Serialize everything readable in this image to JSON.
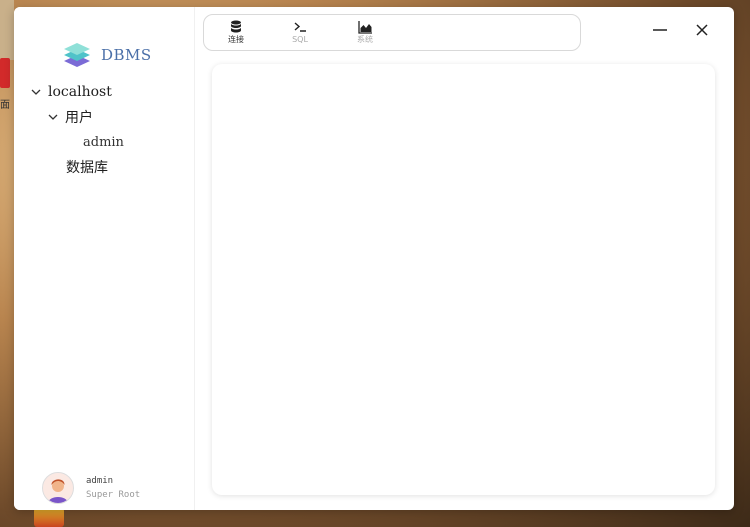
{
  "desktop": {
    "left_char": "面"
  },
  "app": {
    "name": "DBMS"
  },
  "toolbar": {
    "connect_label": "连接",
    "sql_label": "SQL",
    "system_label": "系统"
  },
  "tree": {
    "host": "localhost",
    "users": "用户",
    "user_admin": "admin",
    "databases": "数据库"
  },
  "user": {
    "name": "admin",
    "role": "Super Root"
  }
}
